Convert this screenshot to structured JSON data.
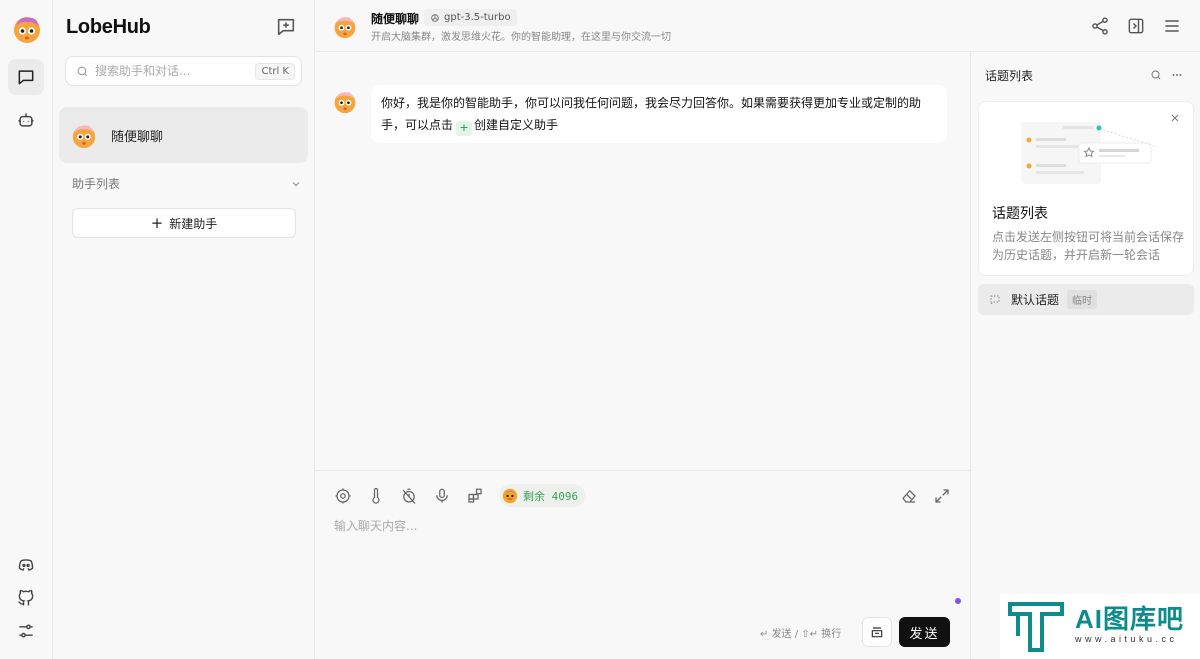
{
  "app": {
    "brand": "LobeHub"
  },
  "sidebar": {
    "search_placeholder": "搜索助手和对话...",
    "search_shortcut": "Ctrl K",
    "sessions": [
      {
        "title": "随便聊聊"
      }
    ],
    "group_label": "助手列表",
    "add_agent_label": "新建助手"
  },
  "header": {
    "title": "随便聊聊",
    "model": "gpt-3.5-turbo",
    "description": "开启大脑集群，激发思维火花。你的智能助理，在这里与你交流一切"
  },
  "chat": {
    "messages": [
      {
        "role": "assistant",
        "text_before": "你好，我是你的智能助手，你可以问我任何问题，我会尽力回答你。如果需要获得更加专业或定制的助手，可以点击",
        "inline_badge": "+",
        "text_after": "创建自定义助手"
      }
    ]
  },
  "composer": {
    "tokens_label": "剩余 4096",
    "placeholder": "输入聊天内容...",
    "hint": "↵ 发送 / ⇧↵ 换行",
    "send_label": "发送"
  },
  "topics": {
    "title": "话题列表",
    "tip_title": "话题列表",
    "tip_desc": "点击发送左侧按钮可将当前会话保存为历史话题，并开启新一轮会话",
    "items": [
      {
        "title": "默认话题",
        "tag": "临时"
      }
    ]
  },
  "watermark": {
    "text": "AI图库吧",
    "url": "www.aituku.cc"
  },
  "colors": {
    "accent_green": "#1a9a5a",
    "send_bg": "#111111",
    "watermark": "#0e8c8c"
  }
}
